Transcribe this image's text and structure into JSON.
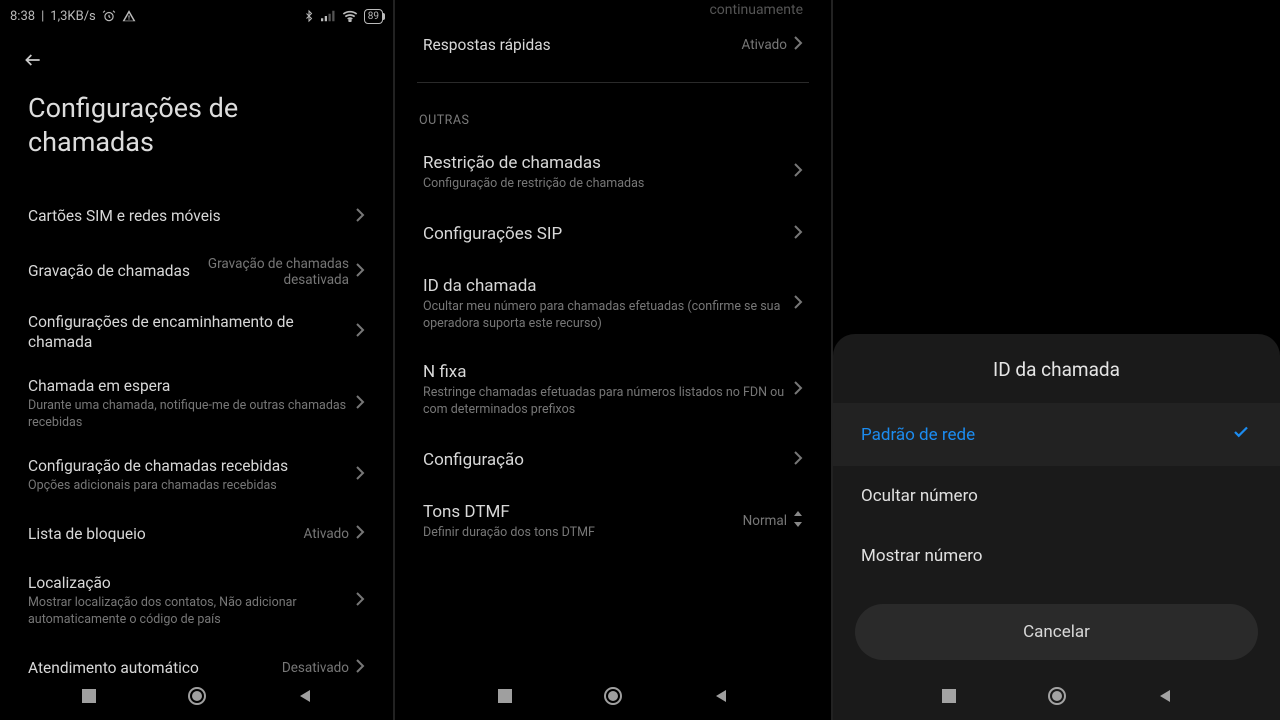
{
  "status": {
    "time": "8:38",
    "speed": "1,3KB/s",
    "battery": "89"
  },
  "screenA": {
    "title": "Configurações de chamadas",
    "items": [
      {
        "title": "Cartões SIM e redes móveis",
        "value": "",
        "sub": ""
      },
      {
        "title": "Gravação de chamadas",
        "value": "Gravação de chamadas desativada",
        "sub": ""
      },
      {
        "title": "Configurações de encaminhamento de chamada",
        "value": "",
        "sub": ""
      },
      {
        "title": "Chamada em espera",
        "value": "",
        "sub": "Durante uma chamada, notifique-me de outras chamadas recebidas"
      },
      {
        "title": "Configuração de chamadas recebidas",
        "value": "",
        "sub": "Opções adicionais para chamadas recebidas"
      },
      {
        "title": "Lista de bloqueio",
        "value": "Ativado",
        "sub": ""
      },
      {
        "title": "Localização",
        "value": "",
        "sub": "Mostrar localização dos contatos, Não adicionar automaticamente o código de país"
      },
      {
        "title": "Atendimento automático",
        "value": "Desativado",
        "sub": ""
      }
    ]
  },
  "screenB": {
    "frag_top": "continuamente",
    "first_item": {
      "title": "Respostas rápidas",
      "value": "Ativado"
    },
    "section_header": "OUTRAS",
    "items": [
      {
        "title": "Restrição de chamadas",
        "sub": "Configuração de restrição de chamadas",
        "value": ""
      },
      {
        "title": "Configurações SIP",
        "sub": "",
        "value": ""
      },
      {
        "title": "ID da chamada",
        "sub": "Ocultar meu número para chamadas efetuadas (confirme se sua operadora suporta este recurso)",
        "value": ""
      },
      {
        "title": "N fixa",
        "sub": "Restringe chamadas efetuadas para números listados no FDN ou com determinados prefixos",
        "value": ""
      },
      {
        "title": "Configuração",
        "sub": "",
        "value": ""
      },
      {
        "title": "Tons DTMF",
        "sub": "Definir duração dos tons DTMF",
        "value": "Normal",
        "updown": true
      }
    ]
  },
  "screenC": {
    "dialog_title": "ID da chamada",
    "options": [
      {
        "label": "Padrão de rede",
        "selected": true
      },
      {
        "label": "Ocultar número",
        "selected": false
      },
      {
        "label": "Mostrar número",
        "selected": false
      }
    ],
    "cancel": "Cancelar"
  }
}
